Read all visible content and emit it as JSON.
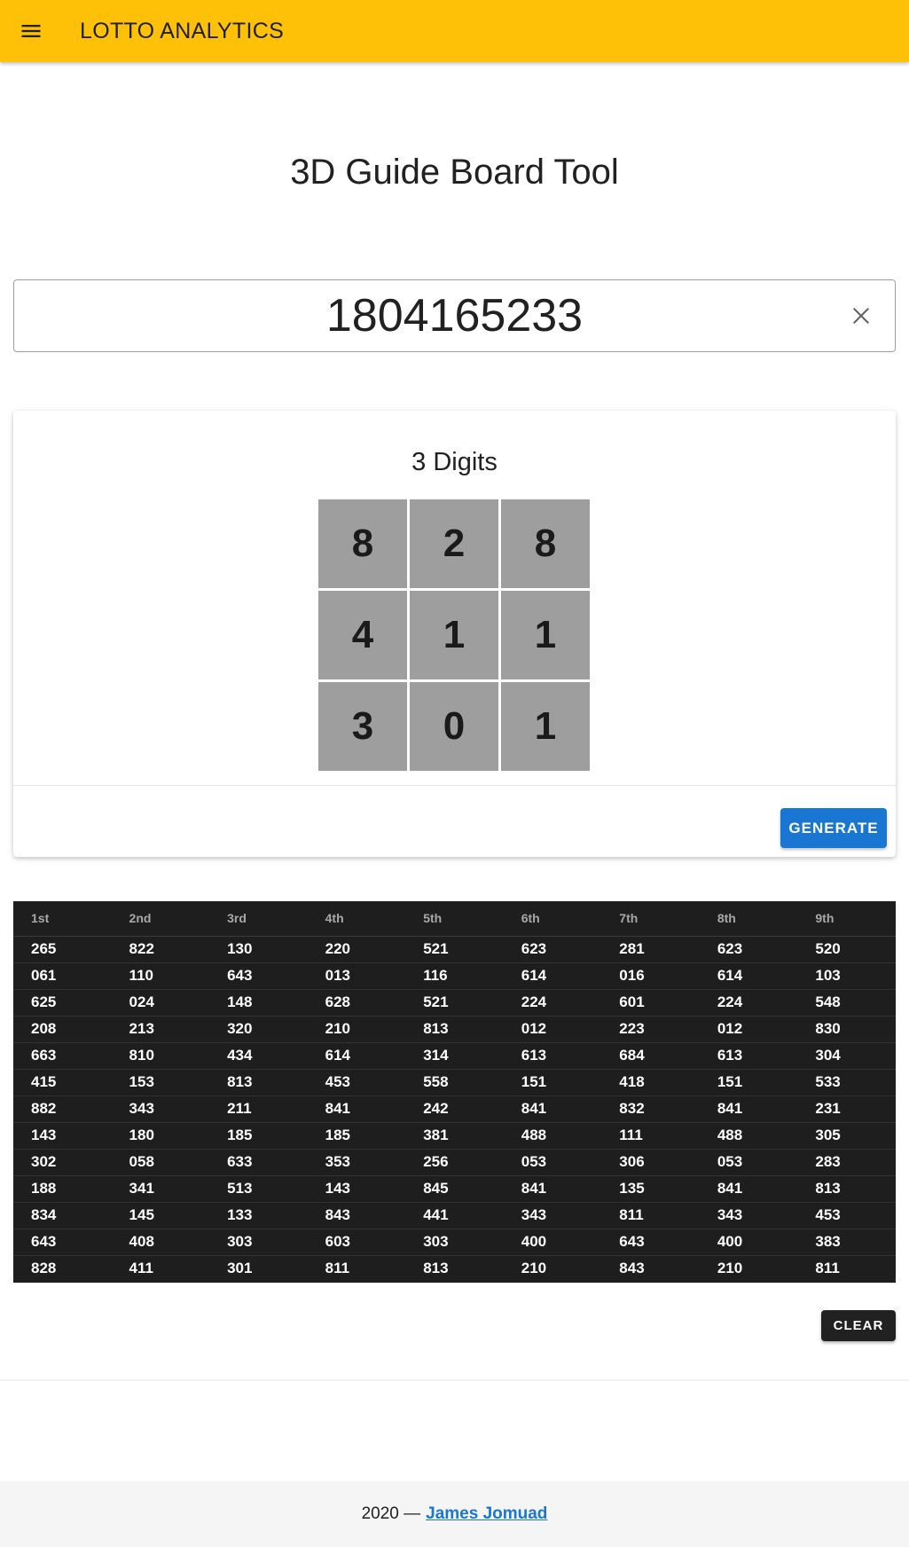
{
  "app": {
    "brand_light": "LOTTO",
    "brand_bold": "ANALYTICS",
    "accent_color": "#ffc107",
    "menu_icon": "hamburger-menu-icon"
  },
  "page": {
    "title": "3D Guide Board Tool"
  },
  "number_input": {
    "value": "1804165233",
    "clear_icon": "close-icon"
  },
  "board": {
    "title": "3 Digits",
    "cells": [
      "8",
      "2",
      "8",
      "4",
      "1",
      "1",
      "3",
      "0",
      "1"
    ],
    "generate_label": "GENERATE",
    "generate_color": "#1976d2"
  },
  "results": {
    "headers": [
      "1st",
      "2nd",
      "3rd",
      "4th",
      "5th",
      "6th",
      "7th",
      "8th",
      "9th"
    ],
    "rows": [
      [
        "265",
        "822",
        "130",
        "220",
        "521",
        "623",
        "281",
        "623",
        "520"
      ],
      [
        "061",
        "110",
        "643",
        "013",
        "116",
        "614",
        "016",
        "614",
        "103"
      ],
      [
        "625",
        "024",
        "148",
        "628",
        "521",
        "224",
        "601",
        "224",
        "548"
      ],
      [
        "208",
        "213",
        "320",
        "210",
        "813",
        "012",
        "223",
        "012",
        "830"
      ],
      [
        "663",
        "810",
        "434",
        "614",
        "314",
        "613",
        "684",
        "613",
        "304"
      ],
      [
        "415",
        "153",
        "813",
        "453",
        "558",
        "151",
        "418",
        "151",
        "533"
      ],
      [
        "882",
        "343",
        "211",
        "841",
        "242",
        "841",
        "832",
        "841",
        "231"
      ],
      [
        "143",
        "180",
        "185",
        "185",
        "381",
        "488",
        "111",
        "488",
        "305"
      ],
      [
        "302",
        "058",
        "633",
        "353",
        "256",
        "053",
        "306",
        "053",
        "283"
      ],
      [
        "188",
        "341",
        "513",
        "143",
        "845",
        "841",
        "135",
        "841",
        "813"
      ],
      [
        "834",
        "145",
        "133",
        "843",
        "441",
        "343",
        "811",
        "343",
        "453"
      ],
      [
        "643",
        "408",
        "303",
        "603",
        "303",
        "400",
        "643",
        "400",
        "383"
      ],
      [
        "828",
        "411",
        "301",
        "811",
        "813",
        "210",
        "843",
        "210",
        "811"
      ]
    ],
    "clear_label": "CLEAR"
  },
  "footer": {
    "prefix": "2020 —",
    "author": "James Jomuad"
  }
}
